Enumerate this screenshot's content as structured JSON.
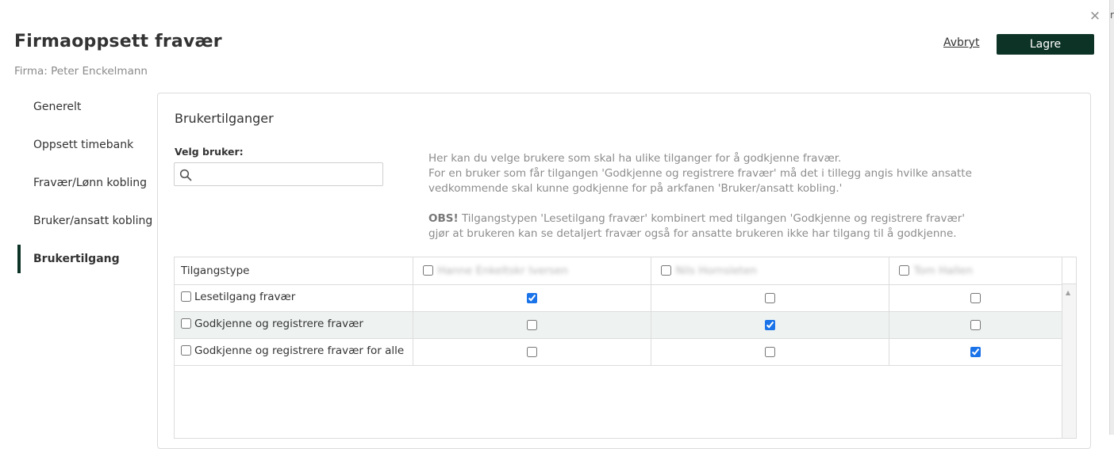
{
  "backdrop": {
    "fragment": "re"
  },
  "dialog": {
    "close_label": "×",
    "title": "Firmaoppsett fravær",
    "subtitle": "Firma: Peter Enckelmann",
    "cancel_label": "Avbryt",
    "save_label": "Lagre"
  },
  "nav": {
    "items": [
      {
        "label": "Generelt",
        "active": false
      },
      {
        "label": "Oppsett timebank",
        "active": false
      },
      {
        "label": "Fravær/Lønn kobling",
        "active": false
      },
      {
        "label": "Bruker/ansatt kobling",
        "active": false
      },
      {
        "label": "Brukertilgang",
        "active": true
      }
    ]
  },
  "panel": {
    "title": "Brukertilganger",
    "user_label": "Velg bruker:",
    "search_placeholder": "",
    "search_value": "",
    "help_line1": "Her kan du velge brukere som skal ha ulike tilganger for å godkjenne fravær.",
    "help_line2": "For en bruker som får tilgangen 'Godkjenne og registrere fravær' må det i tillegg angis hvilke ansatte vedkommende skal kunne godkjenne for på arkfanen 'Bruker/ansatt kobling.'",
    "help_obs_bold": "OBS!",
    "help_obs_text": " Tilgangstypen 'Lesetilgang fravær' kombinert med tilgangen 'Godkjenne og registrere fravær' gjør at brukeren kan se detaljert fravær også for ansatte brukeren ikke har tilgang til å godkjenne."
  },
  "grid": {
    "type_header": "Tilgangstype",
    "users": [
      {
        "name": "Hanne Enkeltskr Iversen",
        "checked": false
      },
      {
        "name": "Nils Hornsleten",
        "checked": false
      },
      {
        "name": "Tom Hallen",
        "checked": false
      }
    ],
    "rows": [
      {
        "label": "Lesetilgang fravær",
        "checked": false,
        "values": [
          true,
          false,
          false
        ]
      },
      {
        "label": "Godkjenne og registrere fravær",
        "checked": false,
        "values": [
          false,
          true,
          false
        ]
      },
      {
        "label": "Godkjenne og registrere fravær for alle",
        "checked": false,
        "values": [
          false,
          false,
          true
        ]
      }
    ]
  },
  "colors": {
    "primary": "#0d3326",
    "muted_text": "#8c8c8c",
    "row_alt": "#eef3f1",
    "checkbox": "#1a73e8"
  },
  "icons": {
    "search": "search-icon",
    "close": "close-icon",
    "scroll_up": "chevron-up-icon"
  }
}
